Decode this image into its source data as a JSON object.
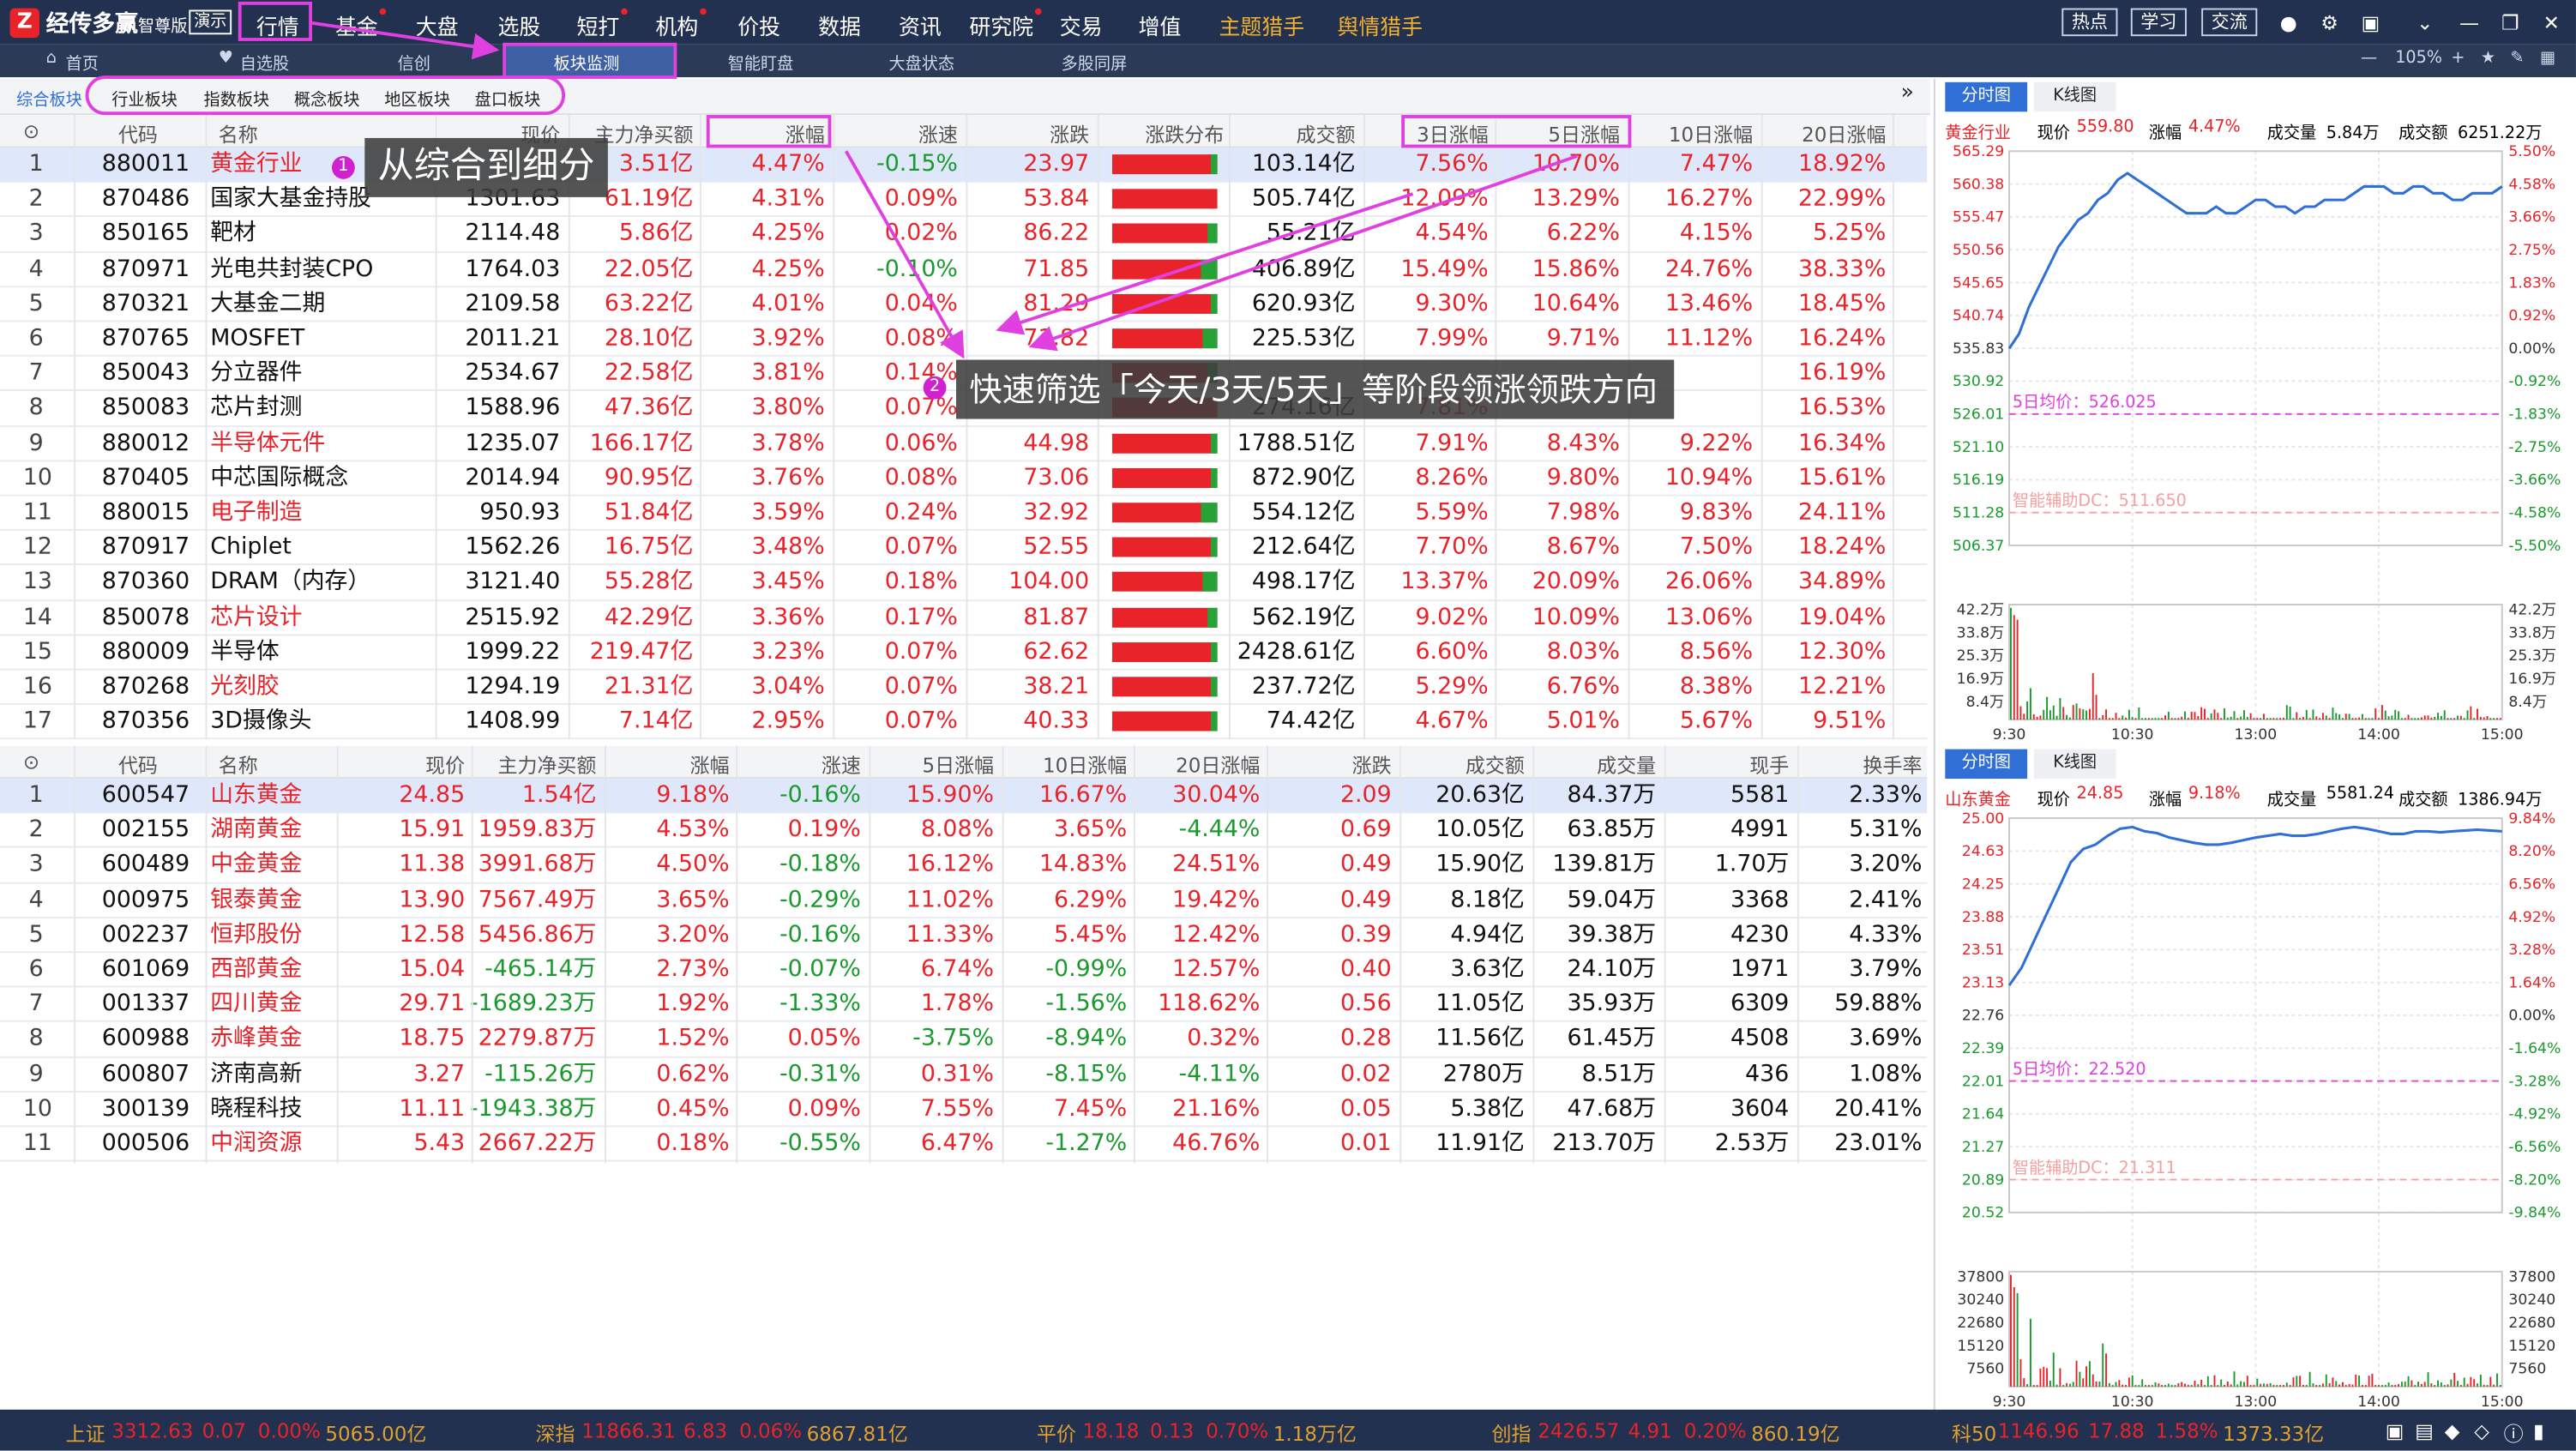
{
  "menubar": {
    "brand": "经传多赢",
    "brand_sub": "智尊版",
    "demo": "演示",
    "items": [
      "行情",
      "基金",
      "大盘",
      "选股",
      "短打",
      "机构",
      "价投",
      "数据",
      "资讯",
      "研究院",
      "交易",
      "增值",
      "主题猎手",
      "舆情猎手"
    ],
    "hot": "热点",
    "study": "学习",
    "exchange": "交流"
  },
  "subbar": {
    "items": [
      "首页",
      "自选股",
      "信创",
      "板块监测",
      "智能盯盘",
      "大盘状态",
      "多股同屏"
    ],
    "zoom": "105%"
  },
  "blocktabs": [
    "综合板块",
    "行业板块",
    "指数板块",
    "概念板块",
    "地区板块",
    "盘口板块"
  ],
  "sector_table": {
    "headers": [
      "代码",
      "名称",
      "现价",
      "主力净买额",
      "涨幅",
      "涨速",
      "涨跌",
      "涨跌分布",
      "成交额",
      "3日涨幅",
      "5日涨幅",
      "10日涨幅",
      "20日涨幅"
    ],
    "rows": [
      [
        "1",
        "880011",
        "黄金行业",
        "",
        "3.51亿",
        "4.47%",
        "-0.15%",
        "23.97",
        "103.14亿",
        "7.56%",
        "10.70%",
        "7.47%",
        "18.92%"
      ],
      [
        "2",
        "870486",
        "国家大基金持股",
        "1301.63",
        "61.19亿",
        "4.31%",
        "0.09%",
        "53.84",
        "505.74亿",
        "12.09%",
        "13.29%",
        "16.27%",
        "22.99%"
      ],
      [
        "3",
        "850165",
        "靶材",
        "2114.48",
        "5.86亿",
        "4.25%",
        "0.02%",
        "86.22",
        "55.21亿",
        "4.54%",
        "6.22%",
        "4.15%",
        "5.25%"
      ],
      [
        "4",
        "870971",
        "光电共封装CPO",
        "1764.03",
        "22.05亿",
        "4.25%",
        "-0.10%",
        "71.85",
        "406.89亿",
        "15.49%",
        "15.86%",
        "24.76%",
        "38.33%"
      ],
      [
        "5",
        "870321",
        "大基金二期",
        "2109.58",
        "63.22亿",
        "4.01%",
        "0.04%",
        "81.29",
        "620.93亿",
        "9.30%",
        "10.64%",
        "13.46%",
        "18.45%"
      ],
      [
        "6",
        "870765",
        "MOSFET",
        "2011.21",
        "28.10亿",
        "3.92%",
        "0.08%",
        "71.82",
        "225.53亿",
        "7.99%",
        "9.71%",
        "11.12%",
        "16.24%"
      ],
      [
        "7",
        "850043",
        "分立器件",
        "2534.67",
        "22.58亿",
        "3.81%",
        "0.14%",
        "",
        "",
        "",
        "",
        "",
        "16.19%"
      ],
      [
        "8",
        "850083",
        "芯片封测",
        "1588.96",
        "47.36亿",
        "3.80%",
        "0.07%",
        "",
        "274.16亿",
        "7.81%",
        "",
        "",
        "16.53%"
      ],
      [
        "9",
        "880012",
        "半导体元件",
        "1235.07",
        "166.17亿",
        "3.78%",
        "0.06%",
        "44.98",
        "1788.51亿",
        "7.91%",
        "8.43%",
        "9.22%",
        "16.34%"
      ],
      [
        "10",
        "870405",
        "中芯国际概念",
        "2014.94",
        "90.95亿",
        "3.76%",
        "0.08%",
        "73.06",
        "872.90亿",
        "8.26%",
        "9.80%",
        "10.94%",
        "15.61%"
      ],
      [
        "11",
        "880015",
        "电子制造",
        "950.93",
        "51.84亿",
        "3.59%",
        "0.24%",
        "32.92",
        "554.12亿",
        "5.59%",
        "7.98%",
        "9.83%",
        "24.11%"
      ],
      [
        "12",
        "870917",
        "Chiplet",
        "1562.26",
        "16.75亿",
        "3.48%",
        "0.07%",
        "52.55",
        "212.64亿",
        "7.70%",
        "8.67%",
        "7.50%",
        "18.24%"
      ],
      [
        "13",
        "870360",
        "DRAM（内存）",
        "3121.40",
        "55.28亿",
        "3.45%",
        "0.18%",
        "104.00",
        "498.17亿",
        "13.37%",
        "20.09%",
        "26.06%",
        "34.89%"
      ],
      [
        "14",
        "850078",
        "芯片设计",
        "2515.92",
        "42.29亿",
        "3.36%",
        "0.17%",
        "81.87",
        "562.19亿",
        "9.02%",
        "10.09%",
        "13.06%",
        "19.04%"
      ],
      [
        "15",
        "880009",
        "半导体",
        "1999.22",
        "219.47亿",
        "3.23%",
        "0.07%",
        "62.62",
        "2428.61亿",
        "6.60%",
        "8.03%",
        "8.56%",
        "12.30%"
      ],
      [
        "16",
        "870268",
        "光刻胶",
        "1294.19",
        "21.31亿",
        "3.04%",
        "0.07%",
        "38.21",
        "237.72亿",
        "5.29%",
        "6.76%",
        "8.38%",
        "12.21%"
      ],
      [
        "17",
        "870356",
        "3D摄像头",
        "1408.99",
        "7.14亿",
        "2.95%",
        "0.07%",
        "40.33",
        "74.42亿",
        "4.67%",
        "5.01%",
        "5.67%",
        "9.51%"
      ]
    ],
    "red_names": [
      "黄金行业",
      "半导体元件",
      "电子制造",
      "芯片设计",
      "光刻胶"
    ],
    "dist": [
      0.06,
      0.0,
      0.1,
      0.16,
      0.06,
      0.14,
      0.1,
      0.0,
      0.06,
      0.06,
      0.16,
      0.06,
      0.14,
      0.1,
      0.06,
      0.06,
      0.06
    ]
  },
  "stock_table": {
    "headers": [
      "代码",
      "名称",
      "现价",
      "主力净买额",
      "涨幅",
      "涨速",
      "5日涨幅",
      "10日涨幅",
      "20日涨幅",
      "涨跌",
      "成交额",
      "成交量",
      "现手",
      "换手率"
    ],
    "rows": [
      [
        "1",
        "600547",
        "山东黄金",
        "24.85",
        "1.54亿",
        "9.18%",
        "-0.16%",
        "15.90%",
        "16.67%",
        "30.04%",
        "2.09",
        "20.63亿",
        "84.37万",
        "5581",
        "2.33%"
      ],
      [
        "2",
        "002155",
        "湖南黄金",
        "15.91",
        "1959.83万",
        "4.53%",
        "0.19%",
        "8.08%",
        "3.65%",
        "-4.44%",
        "0.69",
        "10.05亿",
        "63.85万",
        "4991",
        "5.31%"
      ],
      [
        "3",
        "600489",
        "中金黄金",
        "11.38",
        "3991.68万",
        "4.50%",
        "-0.18%",
        "16.12%",
        "14.83%",
        "24.51%",
        "0.49",
        "15.90亿",
        "139.81万",
        "1.70万",
        "3.20%"
      ],
      [
        "4",
        "000975",
        "银泰黄金",
        "13.90",
        "7567.49万",
        "3.65%",
        "-0.29%",
        "11.02%",
        "6.29%",
        "19.42%",
        "0.49",
        "8.18亿",
        "59.04万",
        "3368",
        "2.41%"
      ],
      [
        "5",
        "002237",
        "恒邦股份",
        "12.58",
        "5456.86万",
        "3.20%",
        "-0.16%",
        "11.33%",
        "5.45%",
        "12.42%",
        "0.39",
        "4.94亿",
        "39.38万",
        "4230",
        "4.33%"
      ],
      [
        "6",
        "601069",
        "西部黄金",
        "15.04",
        "-465.14万",
        "2.73%",
        "-0.07%",
        "6.74%",
        "-0.99%",
        "12.57%",
        "0.40",
        "3.63亿",
        "24.10万",
        "1971",
        "3.79%"
      ],
      [
        "7",
        "001337",
        "四川黄金",
        "29.71",
        "-1689.23万",
        "1.92%",
        "-1.33%",
        "1.78%",
        "-1.56%",
        "118.62%",
        "0.56",
        "11.05亿",
        "35.93万",
        "6309",
        "59.88%"
      ],
      [
        "8",
        "600988",
        "赤峰黄金",
        "18.75",
        "2279.87万",
        "1.52%",
        "0.05%",
        "-3.75%",
        "-8.94%",
        "0.32%",
        "0.28",
        "11.56亿",
        "61.45万",
        "4508",
        "3.69%"
      ],
      [
        "9",
        "600807",
        "济南高新",
        "3.27",
        "-115.26万",
        "0.62%",
        "-0.31%",
        "0.31%",
        "-8.15%",
        "-4.11%",
        "0.02",
        "2780万",
        "8.51万",
        "436",
        "1.08%"
      ],
      [
        "10",
        "300139",
        "晓程科技",
        "11.11",
        "-1943.38万",
        "0.45%",
        "0.09%",
        "7.55%",
        "7.45%",
        "21.16%",
        "0.05",
        "5.38亿",
        "47.68万",
        "3604",
        "20.41%"
      ],
      [
        "11",
        "000506",
        "中润资源",
        "5.43",
        "2667.22万",
        "0.18%",
        "-0.55%",
        "6.47%",
        "-1.27%",
        "46.76%",
        "0.01",
        "11.91亿",
        "213.70万",
        "2.53万",
        "23.01%"
      ]
    ]
  },
  "chart1": {
    "tabs": [
      "分时图",
      "K线图"
    ],
    "name": "黄金行业",
    "price_label": "现价",
    "price": "559.80",
    "chg_label": "涨幅",
    "chg": "4.47%",
    "vol_label": "成交量",
    "vol": "5.84万",
    "amt_label": "成交额",
    "amt": "6251.22万",
    "left_ticks": [
      "565.29",
      "560.38",
      "555.47",
      "550.56",
      "545.65",
      "540.74",
      "535.83",
      "530.92",
      "526.01",
      "521.10",
      "516.19",
      "511.28",
      "506.37"
    ],
    "right_ticks": [
      "5.50%",
      "4.58%",
      "3.66%",
      "2.75%",
      "1.83%",
      "0.92%",
      "0.00%",
      "-0.92%",
      "-1.83%",
      "-2.75%",
      "-3.66%",
      "-4.58%",
      "-5.50%"
    ],
    "vol_ticks": [
      "42.2万",
      "33.8万",
      "25.3万",
      "16.9万",
      "8.4万"
    ],
    "ma_label": "5日均价：526.025",
    "dc_label": "智能辅助DC：511.650",
    "times": [
      "9:30",
      "10:30",
      "13:00",
      "14:00",
      "15:00"
    ],
    "price_series": [
      535.8,
      538,
      542,
      545,
      548,
      551,
      553,
      555,
      556,
      558,
      559,
      561,
      562,
      561,
      560,
      559,
      558,
      557,
      556,
      556,
      556,
      557,
      556,
      556,
      557,
      558,
      558,
      557,
      557,
      556,
      557,
      557,
      558,
      558,
      558,
      559,
      560,
      560,
      560,
      559,
      559,
      560,
      560,
      559,
      559,
      558,
      558,
      559,
      559,
      559,
      560
    ]
  },
  "chart2": {
    "tabs": [
      "分时图",
      "K线图"
    ],
    "name": "山东黄金",
    "price_label": "现价",
    "price": "24.85",
    "chg_label": "涨幅",
    "chg": "9.18%",
    "vol_label": "成交量",
    "vol": "5581.24",
    "amt_label": "成交额",
    "amt": "1386.94万",
    "left_ticks": [
      "25.00",
      "24.63",
      "24.25",
      "23.88",
      "23.51",
      "23.13",
      "22.76",
      "22.39",
      "22.01",
      "21.64",
      "21.27",
      "20.89",
      "20.52"
    ],
    "right_ticks": [
      "9.84%",
      "8.20%",
      "6.56%",
      "4.92%",
      "3.28%",
      "1.64%",
      "0.00%",
      "-1.64%",
      "-3.28%",
      "-4.92%",
      "-6.56%",
      "-8.20%",
      "-9.84%"
    ],
    "vol_ticks": [
      "37800",
      "30240",
      "22680",
      "15120",
      "7560"
    ],
    "ma_label": "5日均价：22.520",
    "dc_label": "智能辅助DC：21.311",
    "times": [
      "9:30",
      "10:30",
      "13:00",
      "14:00",
      "15:00"
    ],
    "price_series": [
      23.1,
      23.3,
      23.6,
      23.9,
      24.2,
      24.5,
      24.65,
      24.7,
      24.8,
      24.88,
      24.9,
      24.85,
      24.83,
      24.78,
      24.75,
      24.72,
      24.7,
      24.7,
      24.72,
      24.75,
      24.78,
      24.8,
      24.82,
      24.8,
      24.8,
      24.82,
      24.85,
      24.88,
      24.9,
      24.88,
      24.85,
      24.82,
      24.82,
      24.85,
      24.85,
      24.84,
      24.85,
      24.86,
      24.87,
      24.86,
      24.85
    ]
  },
  "status": {
    "items": [
      {
        "name": "上证",
        "val": "3312.63",
        "chg": "0.07",
        "pct": "0.00%",
        "amt": "5065.00亿"
      },
      {
        "name": "深指",
        "val": "11866.31",
        "chg": "6.83",
        "pct": "0.06%",
        "amt": "6867.81亿"
      },
      {
        "name": "平价",
        "val": "18.18",
        "chg": "0.13",
        "pct": "0.70%",
        "amt": "1.18万亿"
      },
      {
        "name": "创指",
        "val": "2426.57",
        "chg": "4.91",
        "pct": "0.20%",
        "amt": "860.19亿"
      },
      {
        "name": "科50",
        "val": "1146.96",
        "chg": "17.88",
        "pct": "1.58%",
        "amt": "1373.33亿"
      }
    ]
  },
  "annotations": {
    "c1_num": "1",
    "c1_text": "从综合到细分",
    "c2_num": "2",
    "c2_text": "快速筛选「今天/3天/5天」等阶段领涨领跌方向"
  },
  "colors": {
    "up": "#e8232a",
    "down": "#1a9a2e",
    "accent": "#e040e0",
    "menu_bg": "#22314f"
  }
}
